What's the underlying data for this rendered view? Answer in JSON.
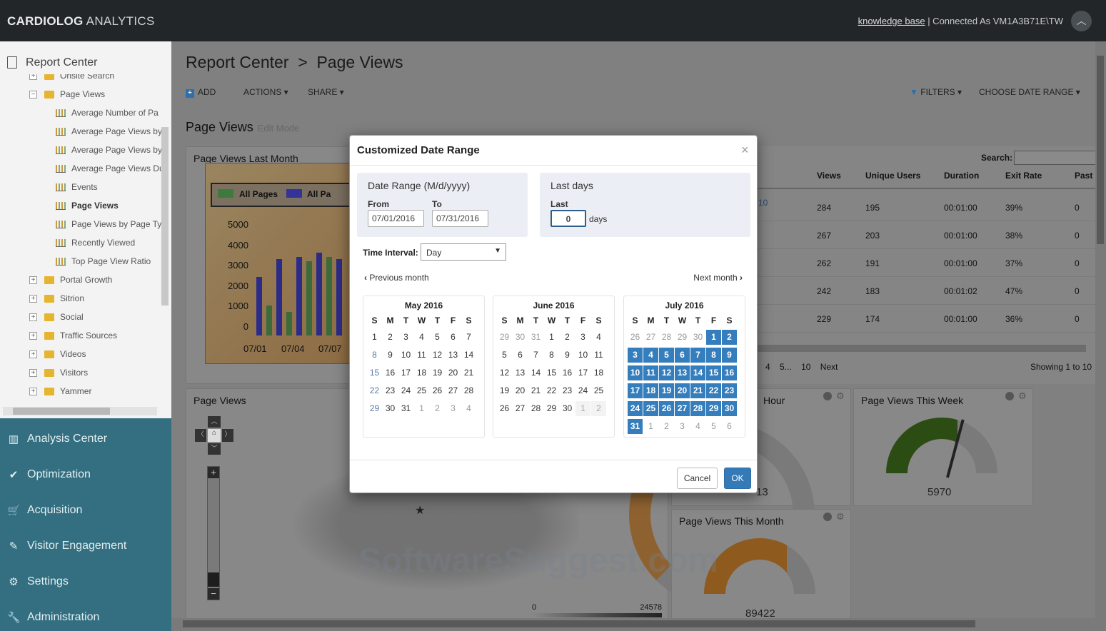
{
  "app": {
    "brand_bold": "CARDIOLOG",
    "brand_rest": " ANALYTICS",
    "knowledge_base": "knowledge base",
    "connected": " | Connected As VM1A3B71E\\TW"
  },
  "sidebar": {
    "report_center": "Report Center",
    "tree": [
      {
        "label": "Onsite Search",
        "type": "folder-collapsed-partial",
        "level": 1
      },
      {
        "label": "Page Views",
        "type": "folder-open",
        "level": 1
      },
      {
        "label": "Average Number of Pa",
        "type": "report",
        "level": 2
      },
      {
        "label": "Average Page Views by",
        "type": "report",
        "level": 2
      },
      {
        "label": "Average Page Views by",
        "type": "report",
        "level": 2
      },
      {
        "label": "Average Page Views Du",
        "type": "report",
        "level": 2
      },
      {
        "label": "Events",
        "type": "report",
        "level": 2
      },
      {
        "label": "Page Views",
        "type": "report",
        "level": 2,
        "selected": true
      },
      {
        "label": "Page Views by Page Ty",
        "type": "report",
        "level": 2
      },
      {
        "label": "Recently Viewed",
        "type": "report",
        "level": 2
      },
      {
        "label": "Top Page View Ratio",
        "type": "report",
        "level": 2
      },
      {
        "label": "Portal Growth",
        "type": "folder",
        "level": 1
      },
      {
        "label": "Sitrion",
        "type": "folder",
        "level": 1
      },
      {
        "label": "Social",
        "type": "folder",
        "level": 1
      },
      {
        "label": "Traffic Sources",
        "type": "folder",
        "level": 1
      },
      {
        "label": "Videos",
        "type": "folder",
        "level": 1
      },
      {
        "label": "Visitors",
        "type": "folder",
        "level": 1
      },
      {
        "label": "Yammer",
        "type": "folder",
        "level": 1
      }
    ],
    "nav": [
      {
        "label": "Analysis Center",
        "icon": "bar-chart-icon",
        "glyph": "▥"
      },
      {
        "label": "Optimization",
        "icon": "check-icon",
        "glyph": "✔"
      },
      {
        "label": "Acquisition",
        "icon": "cart-icon",
        "glyph": "🛒"
      },
      {
        "label": "Visitor Engagement",
        "icon": "pencil-icon",
        "glyph": "✎"
      },
      {
        "label": "Settings",
        "icon": "gears-icon",
        "glyph": "⚙"
      },
      {
        "label": "Administration",
        "icon": "wrench-icon",
        "glyph": "🔧"
      }
    ]
  },
  "main": {
    "title": "Report Center  >  Page Views",
    "toolbar": {
      "add": "ADD",
      "actions": "ACTIONS",
      "share": "SHARE",
      "filters": "FILTERS",
      "date_range": "CHOOSE DATE RANGE"
    },
    "section_title": "Page Views",
    "edit_mode": "Edit Mode",
    "panel_last_month": "Page Views Last Month",
    "legend": [
      "All Pages",
      "All Pa"
    ],
    "y_ticks": [
      "5000",
      "4000",
      "3000",
      "2000",
      "1000",
      "0"
    ],
    "x_ticks": [
      "07/01",
      "07/04",
      "07/07"
    ],
    "panel_map": "Page Views",
    "map_scale": [
      "0",
      "24578"
    ],
    "search_label": "Search:",
    "table_headers": [
      "Views",
      "Unique Users",
      "Duration",
      "Exit Rate",
      "Past"
    ],
    "table_rows": [
      [
        "284",
        "195",
        "00:01:00",
        "39%",
        "0"
      ],
      [
        "267",
        "203",
        "00:01:00",
        "38%",
        "0"
      ],
      [
        "262",
        "191",
        "00:01:00",
        "37%",
        "0"
      ],
      [
        "242",
        "183",
        "00:01:02",
        "47%",
        "0"
      ],
      [
        "229",
        "174",
        "00:01:00",
        "36%",
        "0"
      ]
    ],
    "row_link_fragment": "10",
    "pager": [
      "4",
      "5",
      "...",
      "10",
      "Next"
    ],
    "showing": "Showing 1 to 10",
    "panel_hour": "Hour",
    "hour_value": "13",
    "panel_week": "Page Views This Week",
    "week_value": "5970",
    "panel_month": "Page Views This Month",
    "month_value": "89422",
    "watermark": "SoftwareSuggest.com"
  },
  "modal": {
    "title": "Customized Date Range",
    "close": "×",
    "date_range_heading": "Date Range (M/d/yyyy)",
    "from_label": "From",
    "from_value": "07/01/2016",
    "to_label": "To",
    "to_value": "07/31/2016",
    "last_days_heading": "Last days",
    "last_label": "Last",
    "last_value": "0",
    "days_label": "days",
    "interval_label": "Time Interval:",
    "interval_value": "Day",
    "prev_month": "Previous month",
    "next_month": "Next month",
    "dow": [
      "S",
      "M",
      "T",
      "W",
      "T",
      "F",
      "S"
    ],
    "calendars": [
      {
        "title": "May 2016",
        "weeks": [
          [
            "1",
            "2",
            "3",
            "4",
            "5",
            "6",
            "7"
          ],
          [
            "8",
            "9",
            "10",
            "11",
            "12",
            "13",
            "14"
          ],
          [
            "15",
            "16",
            "17",
            "18",
            "19",
            "20",
            "21"
          ],
          [
            "22",
            "23",
            "24",
            "25",
            "26",
            "27",
            "28"
          ],
          [
            "29",
            "30",
            "31",
            "1",
            "2",
            "3",
            "4"
          ]
        ],
        "other_from": 31
      },
      {
        "title": "June 2016",
        "weeks": [
          [
            "29",
            "30",
            "31",
            "1",
            "2",
            "3",
            "4"
          ],
          [
            "5",
            "6",
            "7",
            "8",
            "9",
            "10",
            "11"
          ],
          [
            "12",
            "13",
            "14",
            "15",
            "16",
            "17",
            "18"
          ],
          [
            "19",
            "20",
            "21",
            "22",
            "23",
            "24",
            "25"
          ],
          [
            "26",
            "27",
            "28",
            "29",
            "30",
            "1",
            "2"
          ]
        ],
        "other_before": 3,
        "disabled_tail": 2
      },
      {
        "title": "July 2016",
        "weeks": [
          [
            "26",
            "27",
            "28",
            "29",
            "30",
            "1",
            "2"
          ],
          [
            "3",
            "4",
            "5",
            "6",
            "7",
            "8",
            "9"
          ],
          [
            "10",
            "11",
            "12",
            "13",
            "14",
            "15",
            "16"
          ],
          [
            "17",
            "18",
            "19",
            "20",
            "21",
            "22",
            "23"
          ],
          [
            "24",
            "25",
            "26",
            "27",
            "28",
            "29",
            "30"
          ],
          [
            "31",
            "1",
            "2",
            "3",
            "4",
            "5",
            "6"
          ]
        ],
        "other_before": 5,
        "selected_last": 31
      }
    ],
    "cancel": "Cancel",
    "ok": "OK"
  },
  "colors": {
    "topbar": "#222629",
    "nav": "#336f80",
    "selected_day": "#357ebd",
    "ok_button": "#337ab7"
  }
}
